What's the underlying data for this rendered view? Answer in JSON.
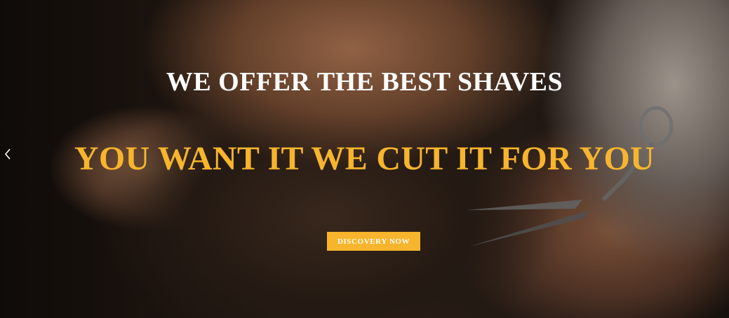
{
  "hero": {
    "subtitle": "WE OFFER THE BEST SHAVES",
    "headline": "YOU WANT IT WE CUT IT FOR YOU",
    "cta_label": "DISCOVERY NOW",
    "prev_icon": "chevron-left-icon",
    "background_image": "bearded-man-beard-trim-photo"
  },
  "colors": {
    "accent": "#f7b52d",
    "subtitle_text": "#ffffff",
    "button_text": "#ffffff"
  }
}
